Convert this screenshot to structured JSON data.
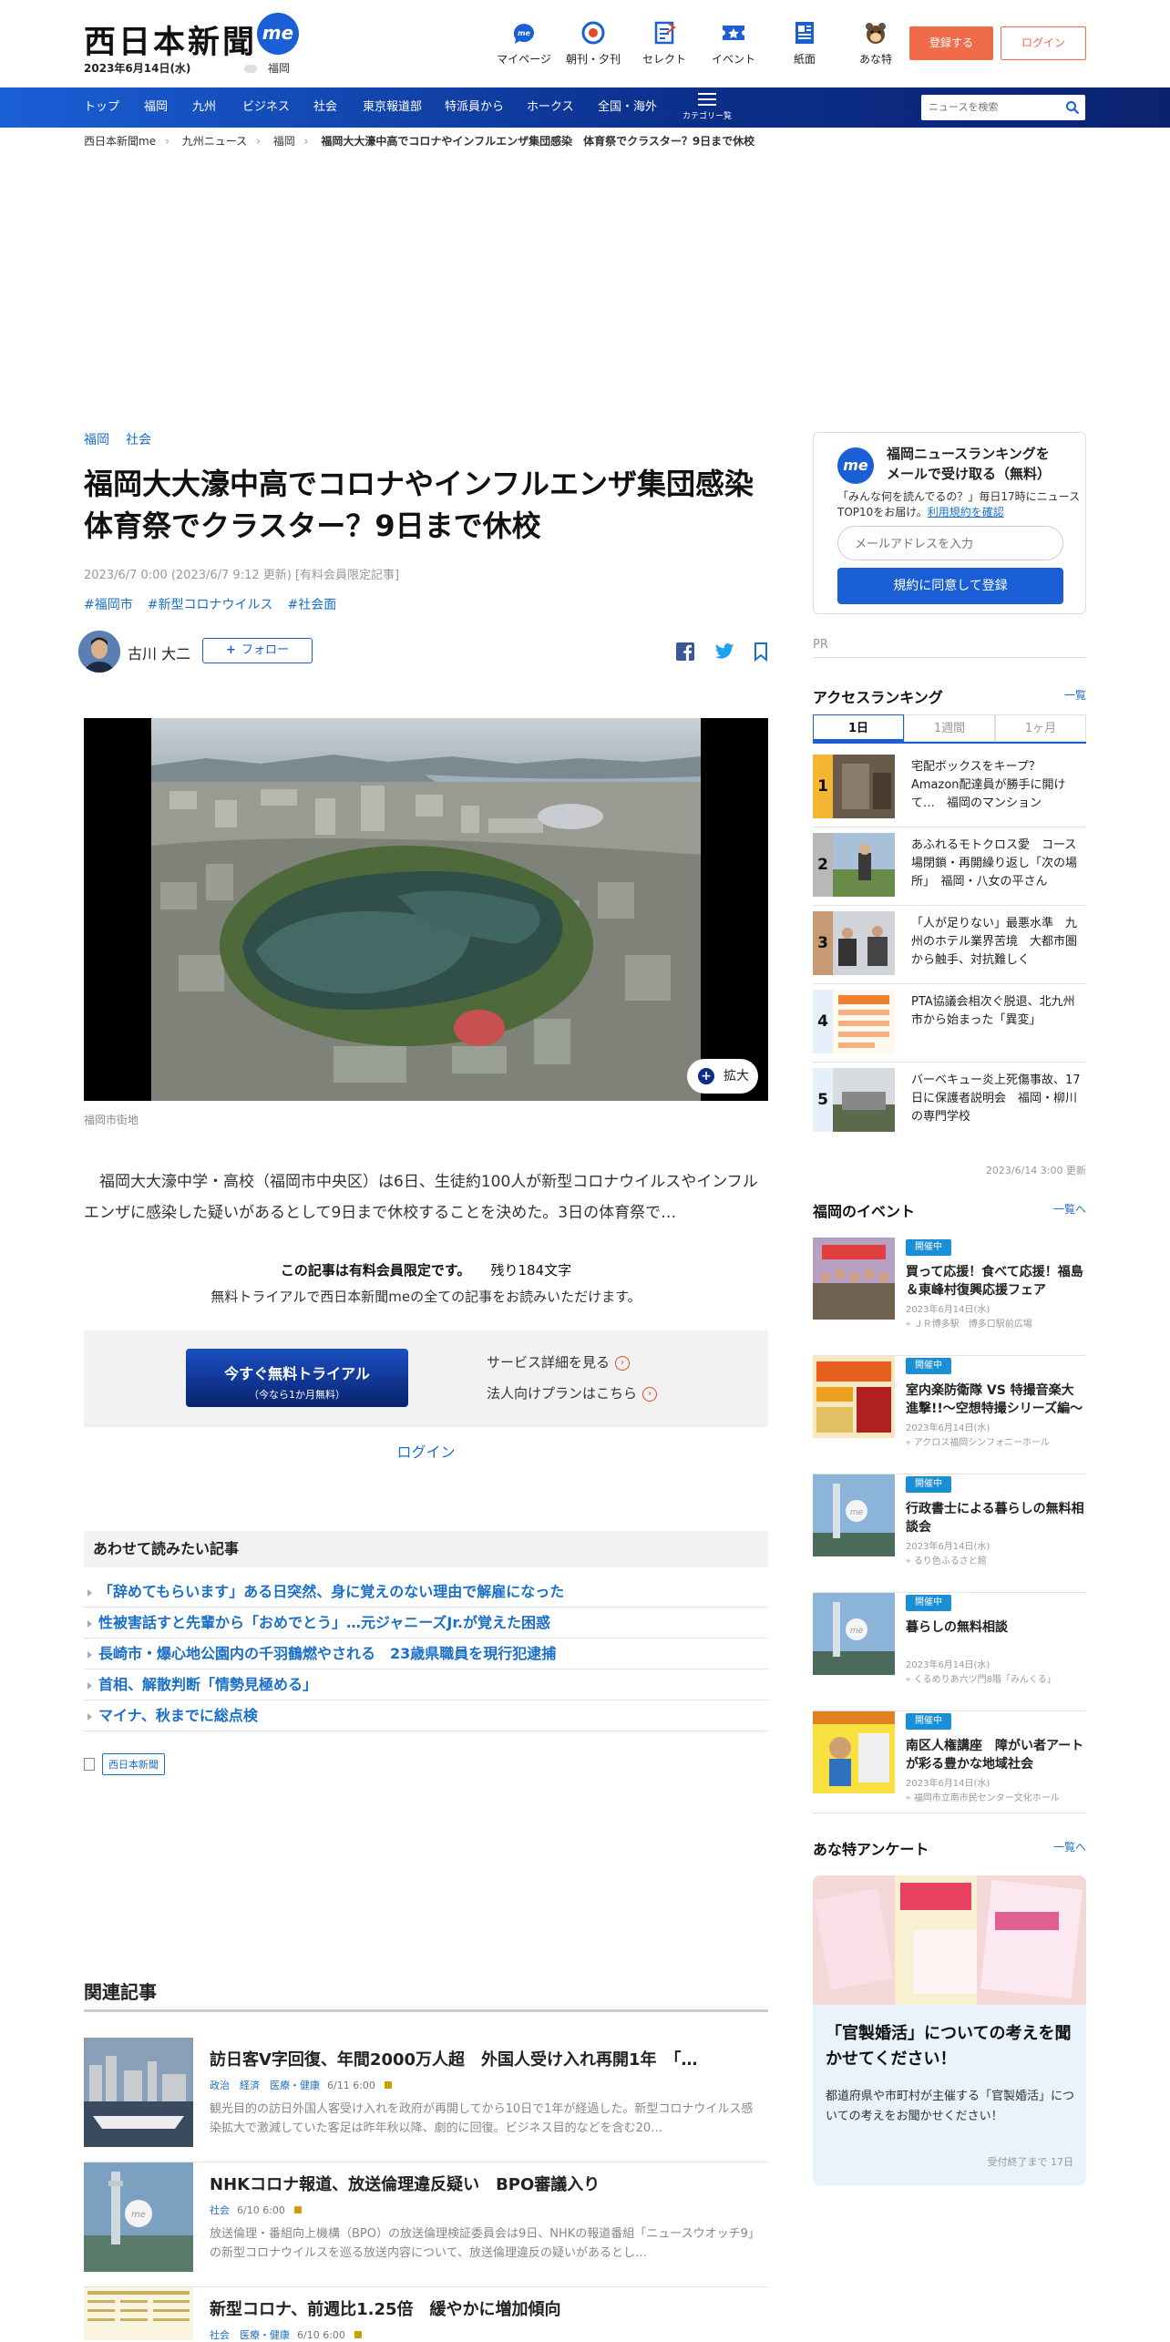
{
  "header": {
    "logo": "西日本新聞",
    "me": "me",
    "date": "2023年6月14日(水)",
    "region": "福岡",
    "nav": [
      {
        "label": "マイページ",
        "icon": "mypage-icon"
      },
      {
        "label": "朝刊・夕刊",
        "icon": "newspaper-edition-icon"
      },
      {
        "label": "セレクト",
        "icon": "select-icon"
      },
      {
        "label": "イベント",
        "icon": "event-ticket-icon"
      },
      {
        "label": "紙面",
        "icon": "paper-icon"
      },
      {
        "label": "あな特",
        "icon": "ana-toku-icon"
      }
    ],
    "register": "登録する",
    "login": "ログイン"
  },
  "gnav": {
    "items": [
      "トップ",
      "福岡",
      "九州",
      "ビジネス",
      "社会",
      "東京報道部",
      "特派員から",
      "ホークス",
      "全国・海外"
    ],
    "category": "カテゴリー覧",
    "search_placeholder": "ニュースを検索"
  },
  "breadcrumb": [
    "西日本新聞me",
    "九州ニュース",
    "福岡",
    "福岡大大濠中高でコロナやインフルエンザ集団感染　体育祭でクラスター？9日まで休校"
  ],
  "article": {
    "categories": [
      "福岡",
      "社会"
    ],
    "title_line1": "福岡大大濠中高でコロナやインフルエンザ集団感染",
    "title_line2": "体育祭でクラスター？9日まで休校",
    "meta": "2023/6/7 0:00 (2023/6/7 9:12 更新) [有料会員限定記事]",
    "hashtags": [
      "#福岡市",
      "#新型コロナウイルス",
      "#社会面"
    ],
    "author": "古川 大二",
    "follow": "フォロー",
    "zoom": "拡大",
    "caption": "福岡市街地",
    "lead": "福岡大大濠中学・高校（福岡市中央区）は6日、生徒約100人が新型コロナウイルスやインフルエンザに感染した疑いがあるとして9日まで休校することを決めた。3日の体育祭で…",
    "paywall": "この記事は有料会員限定です。",
    "remaining": "残り184文字",
    "trial_note": "無料トライアルで西日本新聞meの全ての記事をお読みいただけます。",
    "trial_btn": "今すぐ無料トライアル",
    "trial_sub": "（今なら1か月無料）",
    "service_link": "サービス詳細を見る",
    "corp_link": "法人向けプランはこちら",
    "login": "ログイン"
  },
  "also_read": {
    "heading": "あわせて読みたい記事",
    "items": [
      "「辞めてもらいます」ある日突然、身に覚えのない理由で解雇になった",
      "性被害話すと先輩から「おめでとう」…元ジャニーズJr.が覚えた困惑",
      "長崎市・爆心地公園内の千羽鶴燃やされる　23歳県職員を現行犯逮捕",
      "首相、解散判断「情勢見極める」",
      "マイナ、秋までに総点検"
    ],
    "source": "西日本新聞"
  },
  "related": {
    "heading": "関連記事",
    "items": [
      {
        "title": "訪日客V字回復、年間2000万人超　外国人受け入れ再開1年　「…",
        "tags": "政治　経済　医療・健康",
        "date": "6/11 6:00",
        "desc": "観光目的の訪日外国人客受け入れを政府が再開してから10日で1年が経過した。新型コロナウイルス感染拡大で激減していた客足は昨年秋以降、劇的に回復。ビジネス目的などを含む20…"
      },
      {
        "title": "NHKコロナ報道、放送倫理違反疑い　BPO審議入り",
        "tags": "社会",
        "date": "6/10 6:00",
        "desc": "放送倫理・番組向上機構（BPO）の放送倫理検証委員会は9日、NHKの報道番組「ニュースウオッチ9」の新型コロナウイルスを巡る放送内容について、放送倫理違反の疑いがあるとし…"
      },
      {
        "title": "新型コロナ、前週比1.25倍　緩やかに増加傾向",
        "tags": "社会　医療・健康",
        "date": "6/10 6:00",
        "desc": ""
      }
    ]
  },
  "sidebar": {
    "newsletter": {
      "title": "福岡ニュースランキングを\nメールで受け取る（無料）",
      "desc": "「みんな何を読んでるの？」毎日17時にニュースTOP10をお届け。",
      "terms_link": "利用規約を確認",
      "placeholder": "メールアドレスを入力",
      "button": "規約に同意して登録"
    },
    "pr": "PR",
    "ranking": {
      "heading": "アクセスランキング",
      "more": "一覧",
      "tabs": [
        "1日",
        "1週間",
        "1ヶ月"
      ],
      "items": [
        {
          "rank": "1",
          "title": "宅配ボックスをキープ？Amazon配達員が勝手に開けて…　福岡のマンション"
        },
        {
          "rank": "2",
          "title": "あふれるモトクロス愛　コース場閉鎖・再開繰り返し「次の場所」　福岡・八女の平さん"
        },
        {
          "rank": "3",
          "title": "「人が足りない」最悪水準　九州のホテル業界苦境　大都市圏から触手、対抗難しく"
        },
        {
          "rank": "4",
          "title": "PTA協議会相次ぐ脱退、北九州市から始まった「異変」"
        },
        {
          "rank": "5",
          "title": "バーベキュー炎上死傷事故、17日に保護者説明会　福岡・柳川の専門学校"
        }
      ],
      "updated": "2023/6/14 3:00 更新"
    },
    "events": {
      "heading": "福岡のイベント",
      "more": "一覧へ",
      "badge": "開催中",
      "items": [
        {
          "title": "買って応援！食べて応援！福島＆東峰村復興応援フェア",
          "date": "2023年6月14日(水)",
          "place": "ＪＲ博多駅　博多口駅前広場"
        },
        {
          "title": "室内楽防衛隊 VS 特撮音楽大進撃!!～空想特撮シリーズ編～",
          "date": "2023年6月14日(水)",
          "place": "アクロス福岡シンフォニーホール"
        },
        {
          "title": "行政書士による暮らしの無料相談会",
          "date": "2023年6月14日(水)",
          "place": "るり色ふるさと館"
        },
        {
          "title": "暮らしの無料相談",
          "date": "2023年6月14日(水)",
          "place": "くるめりあ六ツ門8階「みんくる」"
        },
        {
          "title": "南区人権講座　障がい者アートが彩る豊かな地域社会",
          "date": "2023年6月14日(水)",
          "place": "福岡市立南市民センター文化ホール"
        }
      ]
    },
    "survey": {
      "heading": "あな特アンケート",
      "more": "一覧へ",
      "title": "「官製婚活」についての考えを聞かせてください！",
      "desc": "都道府県や市町村が主催する「官製婚活」についての考えをお聞かせください！",
      "end": "受付終了まで 17日"
    }
  },
  "colors": {
    "accent": "#1a5fd6",
    "register": "#f06b4a",
    "link": "#1a6fc9"
  }
}
